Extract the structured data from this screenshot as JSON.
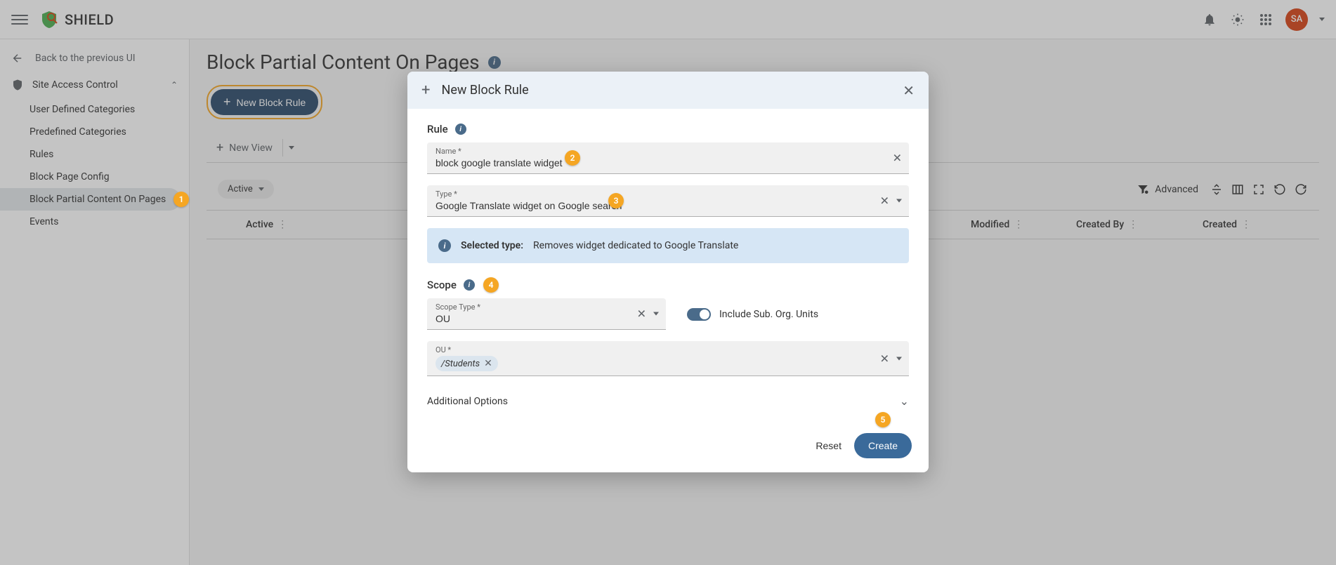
{
  "header": {
    "brand": "SHIELD",
    "avatar_initials": "SA"
  },
  "sidebar": {
    "back_label": "Back to the previous UI",
    "group_label": "Site Access Control",
    "items": [
      "User Defined Categories",
      "Predefined Categories",
      "Rules",
      "Block Page Config",
      "Block Partial Content On Pages",
      "Events"
    ]
  },
  "page": {
    "title": "Block Partial Content On Pages",
    "new_rule_btn": "New Block Rule",
    "new_view": "New View",
    "active_pill": "Active",
    "advanced": "Advanced",
    "columns": {
      "active": "Active",
      "modified": "Modified",
      "created_by": "Created By",
      "created": "Created"
    }
  },
  "dialog": {
    "title": "New Block Rule",
    "rule_section": "Rule",
    "name_label": "Name *",
    "name_value": "block google translate widget",
    "type_label": "Type *",
    "type_value": "Google Translate widget on Google search",
    "selected_type_label": "Selected type:",
    "selected_type_desc": "Removes widget dedicated to Google Translate",
    "scope_section": "Scope",
    "scope_type_label": "Scope Type *",
    "scope_type_value": "OU",
    "include_sub": "Include Sub. Org. Units",
    "ou_label": "OU *",
    "ou_chip": "/Students",
    "additional_options": "Additional Options",
    "reset": "Reset",
    "create": "Create"
  },
  "markers": [
    "1",
    "2",
    "3",
    "4",
    "5"
  ]
}
